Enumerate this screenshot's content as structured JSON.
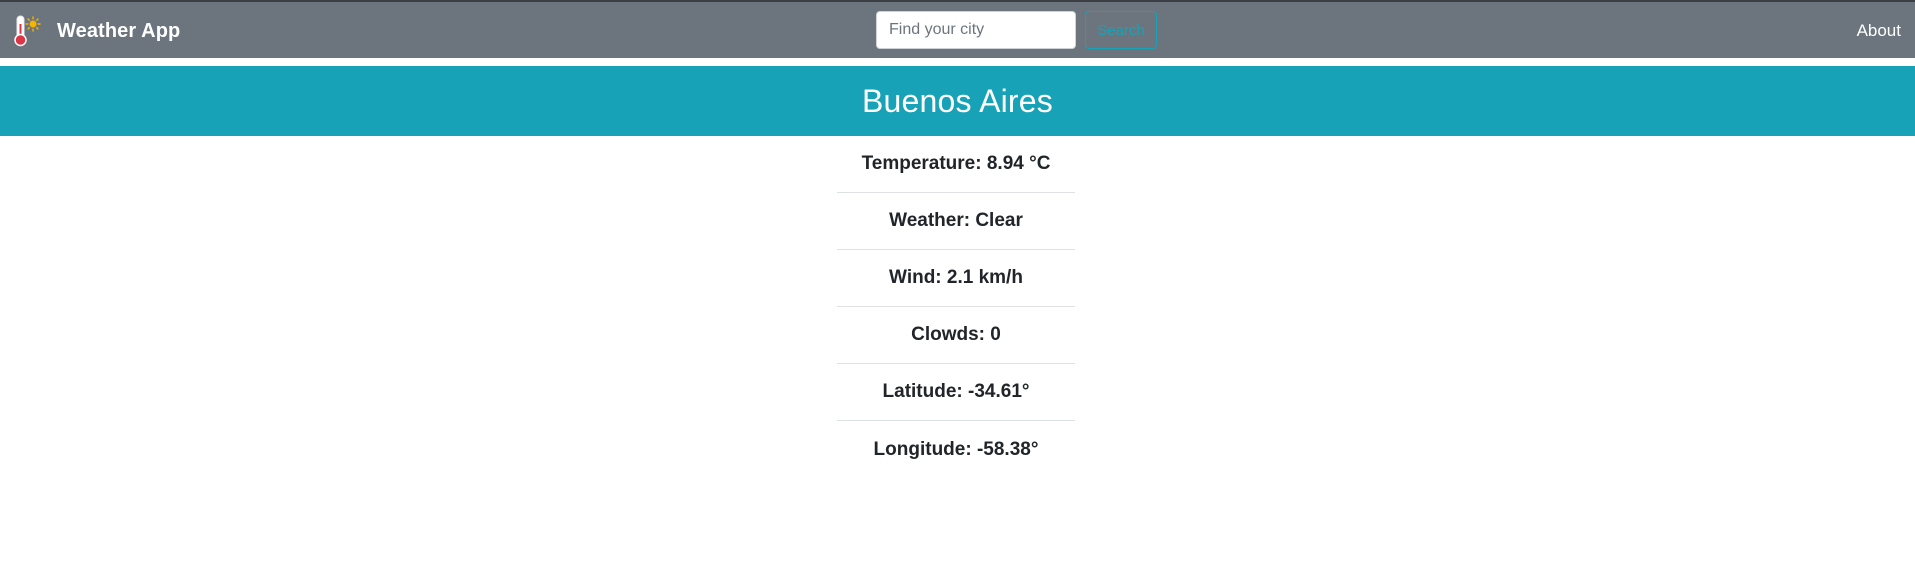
{
  "navbar": {
    "brand": "Weather App",
    "brand_icon": "thermometer-sun-icon",
    "search": {
      "placeholder": "Find your city",
      "value": "",
      "button_label": "Search"
    },
    "about_label": "About"
  },
  "city": {
    "name": "Buenos Aires"
  },
  "details": [
    "Temperature: 8.94 °C",
    "Weather: Clear",
    "Wind: 2.1 km/h",
    "Clowds: 0",
    "Latitude: -34.61°",
    "Longitude: -58.38°"
  ],
  "colors": {
    "navbar": "#6c757d",
    "accent": "#17a2b8",
    "text": "#212529",
    "thermometer_red": "#dc3545",
    "sun_yellow": "#f5b400"
  }
}
